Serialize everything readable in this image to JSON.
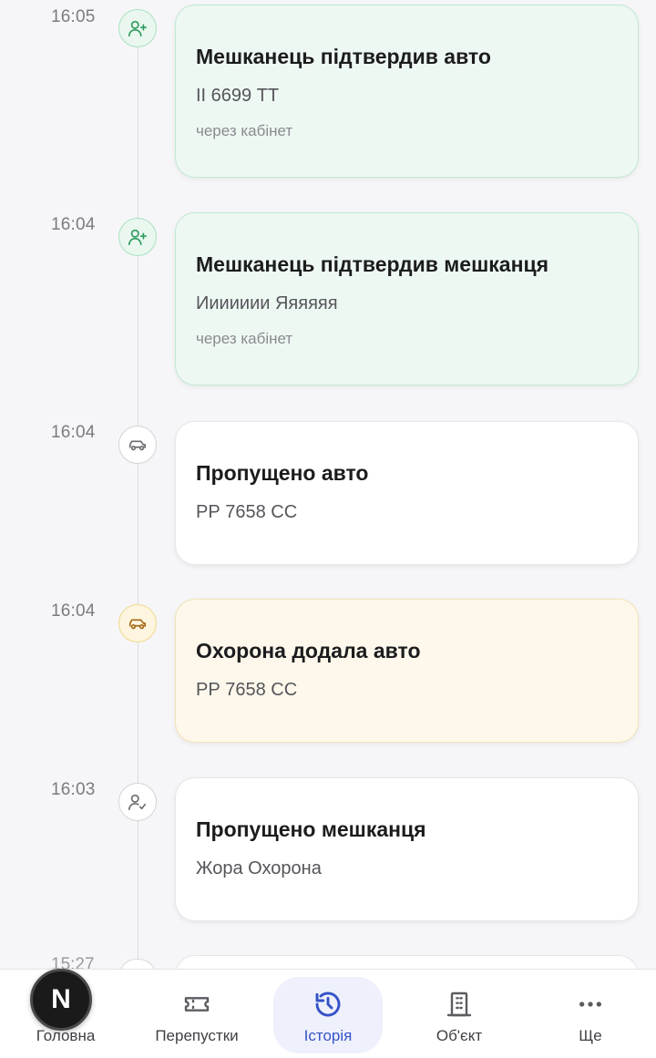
{
  "events": [
    {
      "time": "16:05",
      "icon": "user-plus-icon",
      "style": "green",
      "title": "Мешканець підтвердив авто",
      "subtitle": "ІІ 6699 ТТ",
      "meta": "через кабінет"
    },
    {
      "time": "16:04",
      "icon": "user-plus-icon",
      "style": "green",
      "title": "Мешканець підтвердив мешканця",
      "subtitle": "Иииииии Яяяяяя",
      "meta": "через кабінет"
    },
    {
      "time": "16:04",
      "icon": "car-icon",
      "style": "grey",
      "title": "Пропущено авто",
      "subtitle": "РР 7658 СС",
      "meta": ""
    },
    {
      "time": "16:04",
      "icon": "car-icon",
      "style": "amber",
      "title": "Охорона додала авто",
      "subtitle": "РР 7658 СС",
      "meta": ""
    },
    {
      "time": "16:03",
      "icon": "user-check-icon",
      "style": "grey",
      "title": "Пропущено мешканця",
      "subtitle": "Жора Охорона",
      "meta": ""
    }
  ],
  "partial_event": {
    "time": "15:27"
  },
  "avatar": {
    "letter": "N"
  },
  "nav": {
    "items": [
      {
        "label": "Головна",
        "icon": "home-icon"
      },
      {
        "label": "Перепустки",
        "icon": "ticket-icon"
      },
      {
        "label": "Історія",
        "icon": "history-icon",
        "active": true
      },
      {
        "label": "Об'єкт",
        "icon": "building-icon"
      },
      {
        "label": "Ще",
        "icon": "more-icon"
      }
    ]
  },
  "colors": {
    "accent": "#3553c7",
    "green": "#2f9a5e",
    "amber": "#a66a18"
  }
}
